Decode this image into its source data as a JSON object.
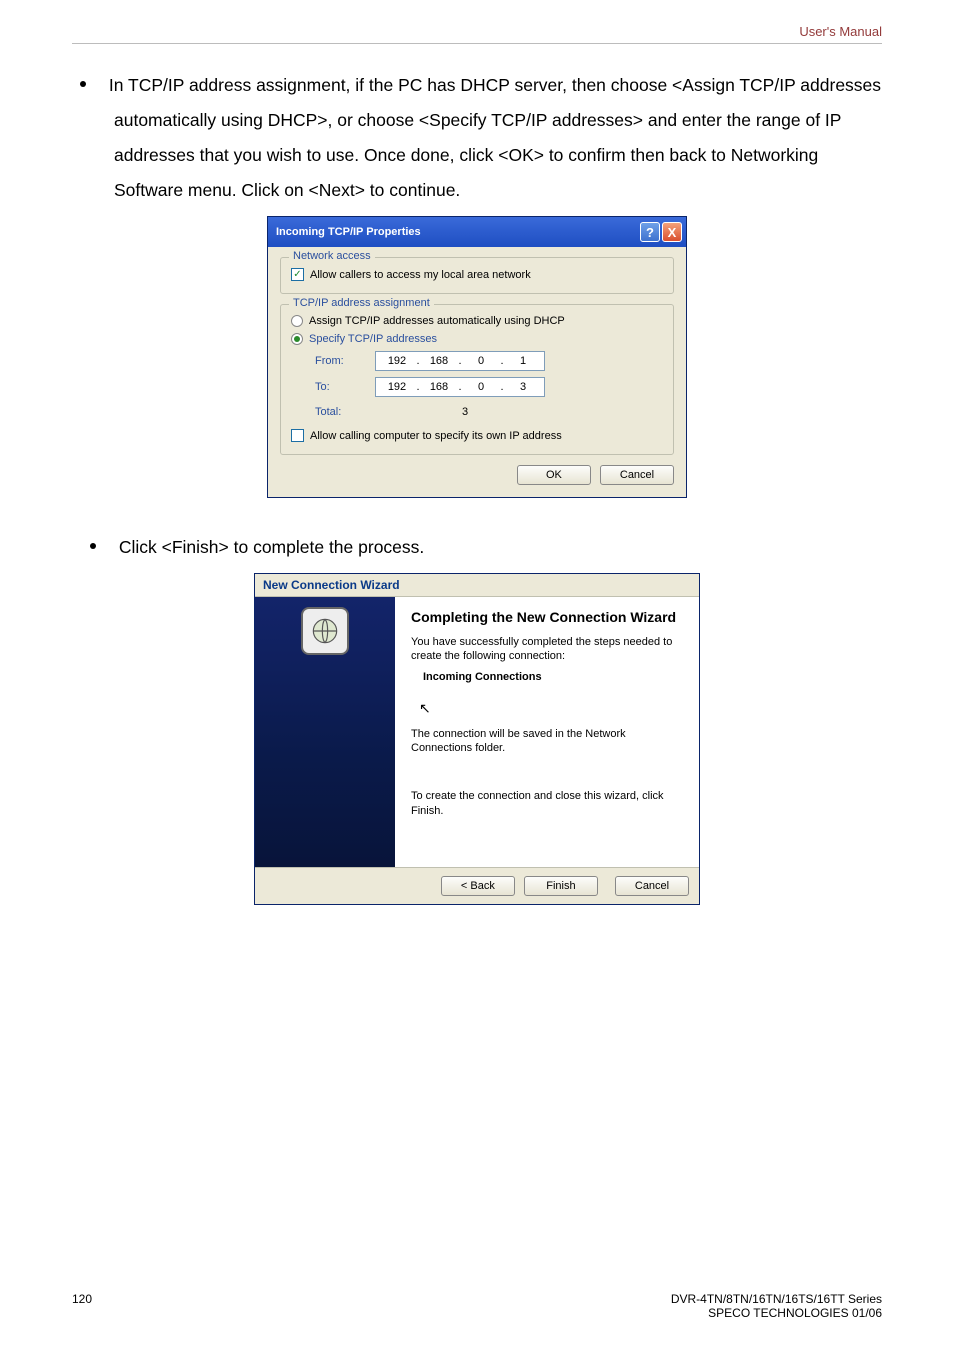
{
  "header": {
    "right": "User's Manual"
  },
  "bullets": {
    "p1": " In TCP/IP address assignment, if the PC has DHCP server, then choose <Assign TCP/IP addresses automatically using DHCP>, or choose <Specify TCP/IP addresses> and enter the range of IP addresses that you wish to use. Once done, click <OK> to confirm then back to Networking Software menu. Click on <Next> to continue.",
    "p2": " Click <Finish> to complete the process."
  },
  "dlg1": {
    "title": "Incoming TCP/IP Properties",
    "help_glyph": "?",
    "close_glyph": "X",
    "group_network": "Network access",
    "allow_callers": "Allow callers to access my local area network",
    "group_tcpip": "TCP/IP address assignment",
    "assign_auto": "Assign TCP/IP addresses automatically using DHCP",
    "specify": "Specify TCP/IP addresses",
    "from_label": "From:",
    "to_label": "To:",
    "total_label": "Total:",
    "from_ip": {
      "o1": "192",
      "o2": "168",
      "o3": "0",
      "o4": "1"
    },
    "to_ip": {
      "o1": "192",
      "o2": "168",
      "o3": "0",
      "o4": "3"
    },
    "total_val": "3",
    "allow_calling": "Allow calling computer to specify its own IP address",
    "ok": "OK",
    "cancel": "Cancel",
    "dot": "."
  },
  "dlg2": {
    "title": "New Connection Wizard",
    "heading": "Completing the New Connection Wizard",
    "line1": "You have successfully completed the steps needed to create the following connection:",
    "conn_name": "Incoming Connections",
    "line2": "The connection will be saved in the Network Connections folder.",
    "line3": "To create the connection and close this wizard, click Finish.",
    "back": "< Back",
    "finish": "Finish",
    "cancel": "Cancel",
    "cursor": "↖"
  },
  "footer": {
    "page": "120",
    "line1": "DVR-4TN/8TN/16TN/16TS/16TT Series",
    "line2": "SPECO TECHNOLOGIES 01/06"
  }
}
